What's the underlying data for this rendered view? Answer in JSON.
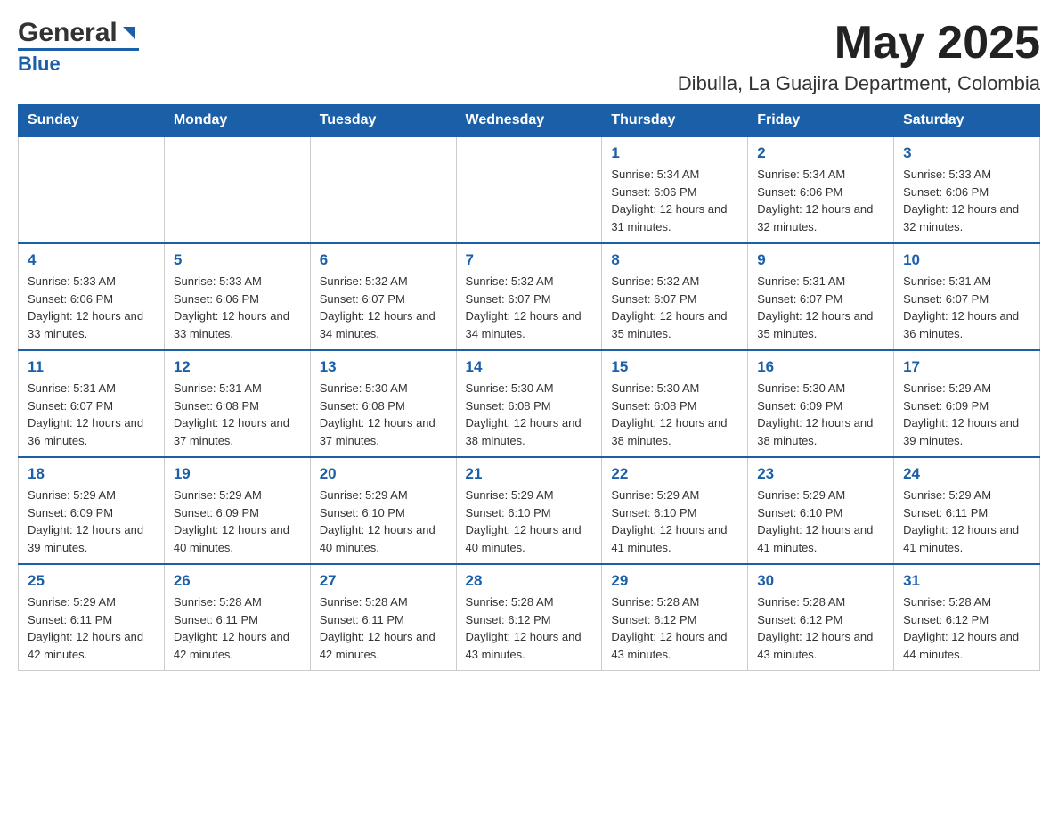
{
  "header": {
    "logo_general": "General",
    "logo_blue": "Blue",
    "month_title": "May 2025",
    "location": "Dibulla, La Guajira Department, Colombia"
  },
  "days_of_week": [
    "Sunday",
    "Monday",
    "Tuesday",
    "Wednesday",
    "Thursday",
    "Friday",
    "Saturday"
  ],
  "weeks": [
    [
      {
        "day": "",
        "info": ""
      },
      {
        "day": "",
        "info": ""
      },
      {
        "day": "",
        "info": ""
      },
      {
        "day": "",
        "info": ""
      },
      {
        "day": "1",
        "info": "Sunrise: 5:34 AM\nSunset: 6:06 PM\nDaylight: 12 hours and 31 minutes."
      },
      {
        "day": "2",
        "info": "Sunrise: 5:34 AM\nSunset: 6:06 PM\nDaylight: 12 hours and 32 minutes."
      },
      {
        "day": "3",
        "info": "Sunrise: 5:33 AM\nSunset: 6:06 PM\nDaylight: 12 hours and 32 minutes."
      }
    ],
    [
      {
        "day": "4",
        "info": "Sunrise: 5:33 AM\nSunset: 6:06 PM\nDaylight: 12 hours and 33 minutes."
      },
      {
        "day": "5",
        "info": "Sunrise: 5:33 AM\nSunset: 6:06 PM\nDaylight: 12 hours and 33 minutes."
      },
      {
        "day": "6",
        "info": "Sunrise: 5:32 AM\nSunset: 6:07 PM\nDaylight: 12 hours and 34 minutes."
      },
      {
        "day": "7",
        "info": "Sunrise: 5:32 AM\nSunset: 6:07 PM\nDaylight: 12 hours and 34 minutes."
      },
      {
        "day": "8",
        "info": "Sunrise: 5:32 AM\nSunset: 6:07 PM\nDaylight: 12 hours and 35 minutes."
      },
      {
        "day": "9",
        "info": "Sunrise: 5:31 AM\nSunset: 6:07 PM\nDaylight: 12 hours and 35 minutes."
      },
      {
        "day": "10",
        "info": "Sunrise: 5:31 AM\nSunset: 6:07 PM\nDaylight: 12 hours and 36 minutes."
      }
    ],
    [
      {
        "day": "11",
        "info": "Sunrise: 5:31 AM\nSunset: 6:07 PM\nDaylight: 12 hours and 36 minutes."
      },
      {
        "day": "12",
        "info": "Sunrise: 5:31 AM\nSunset: 6:08 PM\nDaylight: 12 hours and 37 minutes."
      },
      {
        "day": "13",
        "info": "Sunrise: 5:30 AM\nSunset: 6:08 PM\nDaylight: 12 hours and 37 minutes."
      },
      {
        "day": "14",
        "info": "Sunrise: 5:30 AM\nSunset: 6:08 PM\nDaylight: 12 hours and 38 minutes."
      },
      {
        "day": "15",
        "info": "Sunrise: 5:30 AM\nSunset: 6:08 PM\nDaylight: 12 hours and 38 minutes."
      },
      {
        "day": "16",
        "info": "Sunrise: 5:30 AM\nSunset: 6:09 PM\nDaylight: 12 hours and 38 minutes."
      },
      {
        "day": "17",
        "info": "Sunrise: 5:29 AM\nSunset: 6:09 PM\nDaylight: 12 hours and 39 minutes."
      }
    ],
    [
      {
        "day": "18",
        "info": "Sunrise: 5:29 AM\nSunset: 6:09 PM\nDaylight: 12 hours and 39 minutes."
      },
      {
        "day": "19",
        "info": "Sunrise: 5:29 AM\nSunset: 6:09 PM\nDaylight: 12 hours and 40 minutes."
      },
      {
        "day": "20",
        "info": "Sunrise: 5:29 AM\nSunset: 6:10 PM\nDaylight: 12 hours and 40 minutes."
      },
      {
        "day": "21",
        "info": "Sunrise: 5:29 AM\nSunset: 6:10 PM\nDaylight: 12 hours and 40 minutes."
      },
      {
        "day": "22",
        "info": "Sunrise: 5:29 AM\nSunset: 6:10 PM\nDaylight: 12 hours and 41 minutes."
      },
      {
        "day": "23",
        "info": "Sunrise: 5:29 AM\nSunset: 6:10 PM\nDaylight: 12 hours and 41 minutes."
      },
      {
        "day": "24",
        "info": "Sunrise: 5:29 AM\nSunset: 6:11 PM\nDaylight: 12 hours and 41 minutes."
      }
    ],
    [
      {
        "day": "25",
        "info": "Sunrise: 5:29 AM\nSunset: 6:11 PM\nDaylight: 12 hours and 42 minutes."
      },
      {
        "day": "26",
        "info": "Sunrise: 5:28 AM\nSunset: 6:11 PM\nDaylight: 12 hours and 42 minutes."
      },
      {
        "day": "27",
        "info": "Sunrise: 5:28 AM\nSunset: 6:11 PM\nDaylight: 12 hours and 42 minutes."
      },
      {
        "day": "28",
        "info": "Sunrise: 5:28 AM\nSunset: 6:12 PM\nDaylight: 12 hours and 43 minutes."
      },
      {
        "day": "29",
        "info": "Sunrise: 5:28 AM\nSunset: 6:12 PM\nDaylight: 12 hours and 43 minutes."
      },
      {
        "day": "30",
        "info": "Sunrise: 5:28 AM\nSunset: 6:12 PM\nDaylight: 12 hours and 43 minutes."
      },
      {
        "day": "31",
        "info": "Sunrise: 5:28 AM\nSunset: 6:12 PM\nDaylight: 12 hours and 44 minutes."
      }
    ]
  ]
}
